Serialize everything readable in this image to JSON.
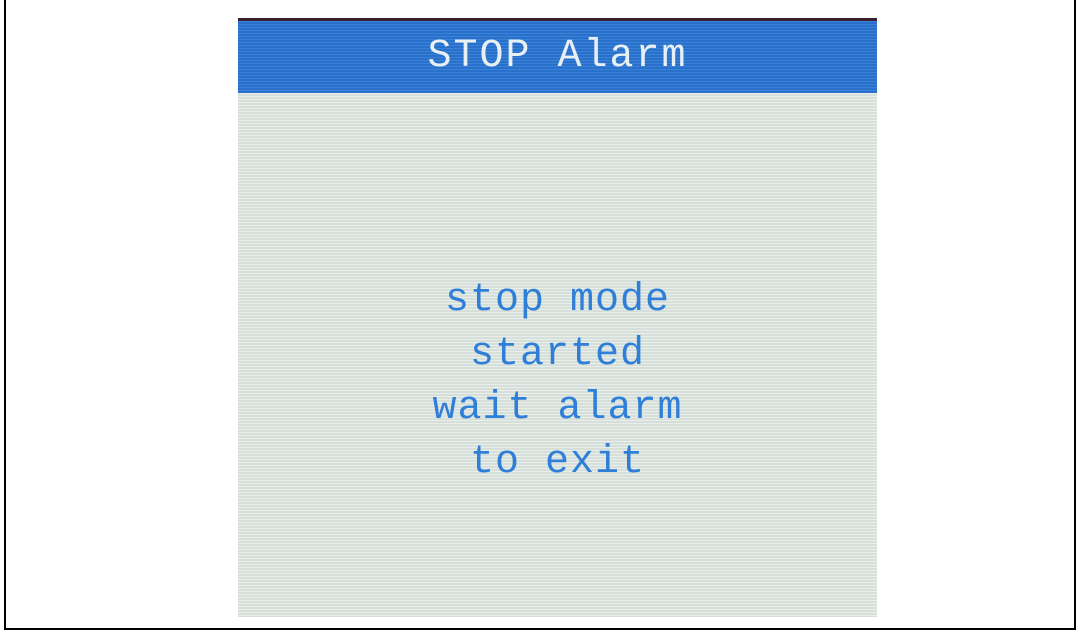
{
  "lcd": {
    "title": "STOP Alarm",
    "message_lines": [
      "stop mode",
      "started",
      "wait alarm",
      "to exit"
    ]
  },
  "colors": {
    "title_bar": "#2a77d6",
    "title_text": "#e8f0f4",
    "screen_background": "#dfe7e2",
    "message_text": "#2f7fd8"
  }
}
